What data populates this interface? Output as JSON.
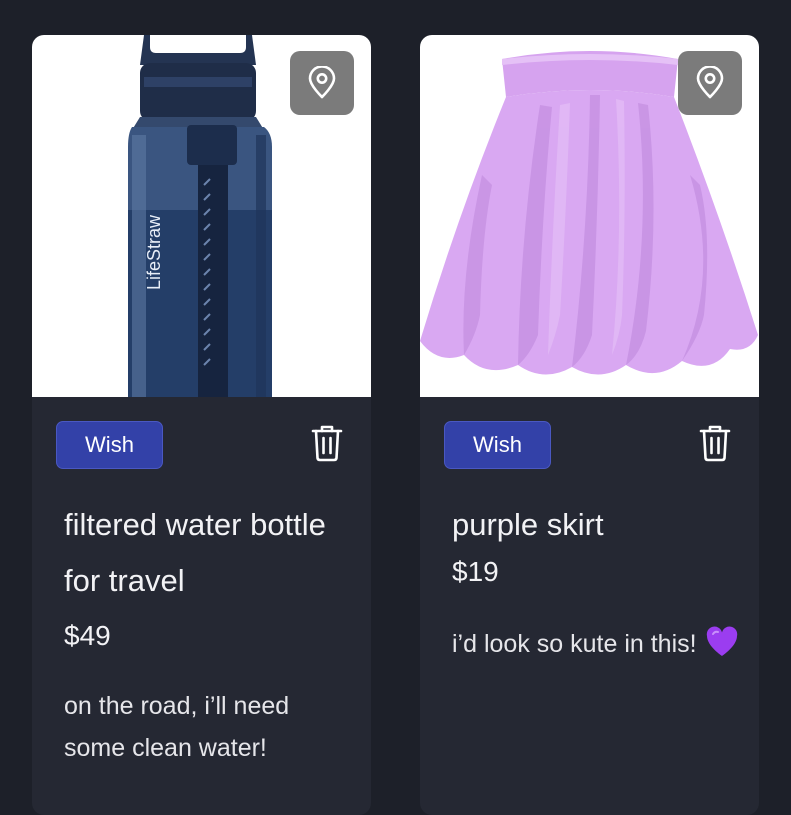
{
  "items": [
    {
      "badge": "Wish",
      "title": "filtered water bottle for travel",
      "price": "$49",
      "note": "on the road, i’ll need some clean water!",
      "product_brand_text": "LifeStraw",
      "icons": {
        "location": "location-pin-icon",
        "delete": "trash-icon"
      }
    },
    {
      "badge": "Wish",
      "title": "purple skirt",
      "price": "$19",
      "note": "i’d look so kute in this!",
      "emoji": "purple-heart-icon",
      "icons": {
        "location": "location-pin-icon",
        "delete": "trash-icon"
      }
    }
  ],
  "colors": {
    "background": "#1d2029",
    "card": "#252833",
    "badge": "#3341a8",
    "text": "#f2f2f5",
    "heart": "#9b3df0",
    "skirt": "#d9a8f2"
  }
}
